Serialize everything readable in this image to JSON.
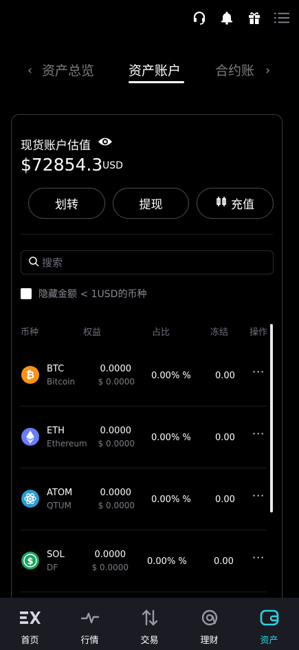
{
  "top_icons": [
    "headset-icon",
    "bell-icon",
    "gift-icon",
    "menu-icon"
  ],
  "tabs": {
    "prev_arrow": "‹",
    "next_arrow": "›",
    "items": [
      {
        "label": "资产总览",
        "active": false
      },
      {
        "label": "资产账户",
        "active": true
      },
      {
        "label": "合约账",
        "active": false
      }
    ]
  },
  "account": {
    "title": "现货账户估值",
    "amount": "$72854.3",
    "unit": "USD",
    "buttons": {
      "transfer": "划转",
      "withdraw": "提现",
      "deposit": "充值"
    }
  },
  "search": {
    "placeholder": "搜索",
    "value": ""
  },
  "hide_small": {
    "label": "隐藏金额 < 1USD的币种",
    "checked": false
  },
  "table": {
    "headers": {
      "coin": "币种",
      "equity": "权益",
      "ratio": "占比",
      "frozen": "冻结",
      "action": "操作"
    },
    "rows": [
      {
        "symbol": "BTC",
        "name": "Bitcoin",
        "balance": "0.0000",
        "balance_usd": "$ 0.0000",
        "ratio": "0.00% %",
        "frozen": "0.00",
        "more": "···",
        "icon": "btc-icon",
        "color": "#f7931a"
      },
      {
        "symbol": "ETH",
        "name": "Ethereum",
        "balance": "0.0000",
        "balance_usd": "$ 0.0000",
        "ratio": "0.00% %",
        "frozen": "0.00",
        "more": "···",
        "icon": "eth-icon",
        "color": "#6b7df5"
      },
      {
        "symbol": "ATOM",
        "name": "QTUM",
        "balance": "0.0000",
        "balance_usd": "$ 0.0000",
        "ratio": "0.00% %",
        "frozen": "0.00",
        "more": "···",
        "icon": "atom-icon",
        "color": "#2e9ad0"
      },
      {
        "symbol": "SOL",
        "name": "DF",
        "balance": "0.0000",
        "balance_usd": "$ 0.0000",
        "ratio": "0.00% %",
        "frozen": "0.00",
        "more": "···",
        "icon": "sol-icon",
        "color": "#1aa360"
      }
    ]
  },
  "nav": [
    {
      "label": "首页",
      "icon": "ex-logo-icon",
      "active": false
    },
    {
      "label": "行情",
      "icon": "pulse-icon",
      "active": false
    },
    {
      "label": "交易",
      "icon": "swap-arrows-icon",
      "active": false
    },
    {
      "label": "理财",
      "icon": "finance-icon",
      "active": false
    },
    {
      "label": "资产",
      "icon": "wallet-icon",
      "active": true
    }
  ],
  "colors": {
    "accent": "#2fd3e0",
    "background": "#000000",
    "nav_background": "#1b1b24"
  }
}
